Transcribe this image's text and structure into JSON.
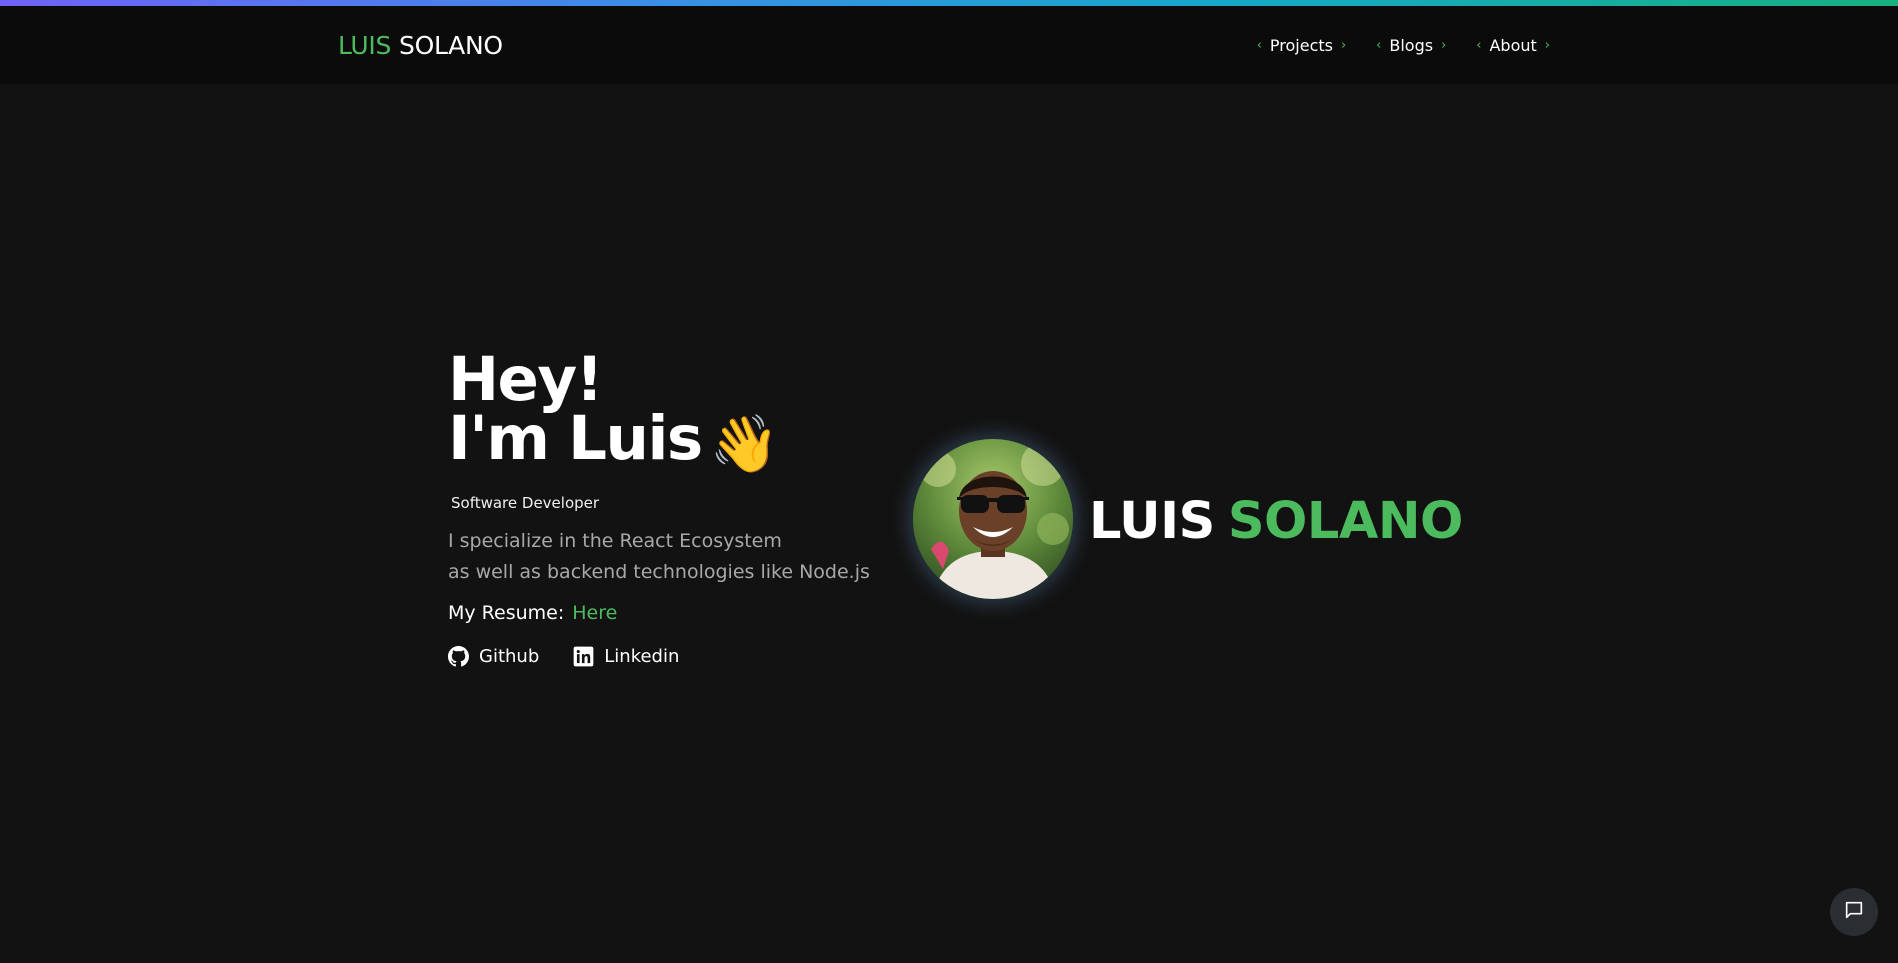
{
  "brand": {
    "first": "LUIS",
    "last": "SOLANO"
  },
  "nav": {
    "items": [
      {
        "label": "Projects"
      },
      {
        "label": "Blogs"
      },
      {
        "label": "About"
      }
    ],
    "chevron_left": "‹",
    "chevron_right": "›"
  },
  "hero": {
    "greeting": "Hey!",
    "intro": "I'm Luis",
    "wave_emoji": "👋",
    "role": "Software Developer",
    "description": [
      "I specialize in the React Ecosystem",
      "as well as backend technologies like Node.js"
    ],
    "resume_label": "My Resume:",
    "resume_link": "Here",
    "socials": [
      {
        "label": "Github",
        "icon": "github-icon"
      },
      {
        "label": "Linkedin",
        "icon": "linkedin-icon"
      }
    ]
  },
  "profile": {
    "name_first": "LUIS",
    "name_last": "SOLANO"
  },
  "chat": {
    "icon": "chat-icon"
  },
  "colors": {
    "accent_green": "#4cbb5e",
    "background": "#121212",
    "navbar": "#0b0b0b",
    "muted_text": "#a8a8a8"
  }
}
